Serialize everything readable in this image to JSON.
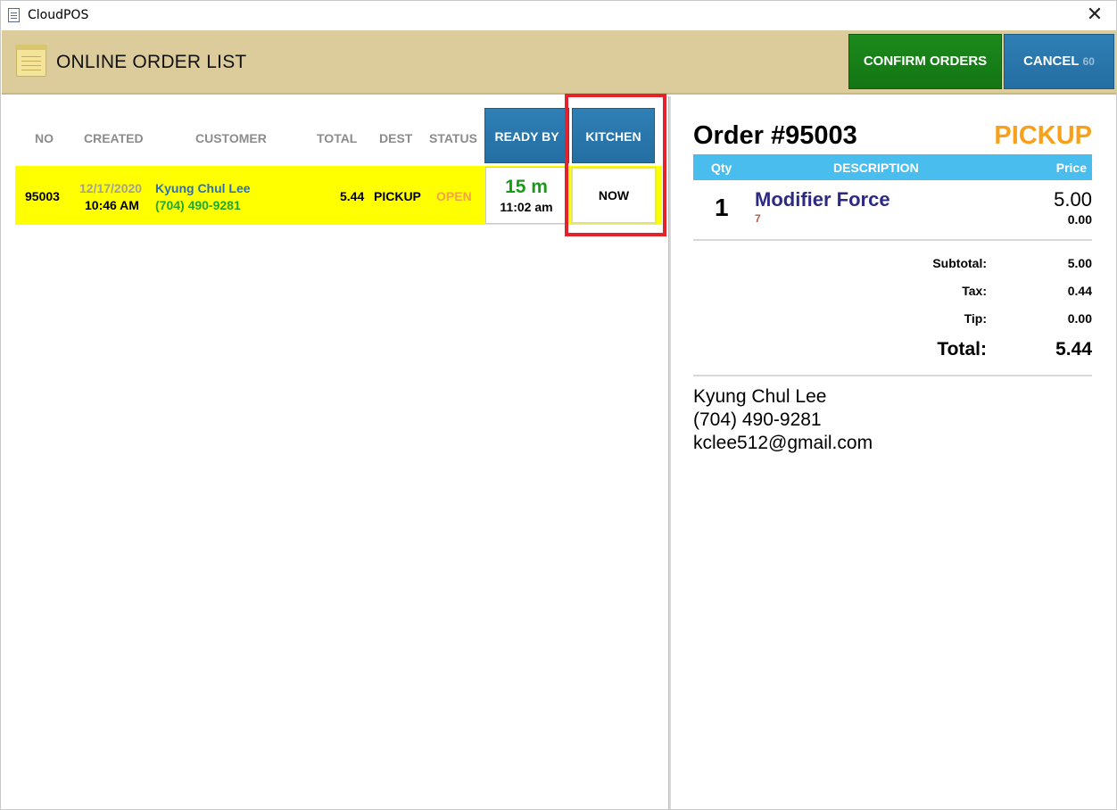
{
  "window": {
    "title": "CloudPOS",
    "close_glyph": "✕"
  },
  "header": {
    "title": "ONLINE ORDER LIST",
    "confirm_label": "CONFIRM ORDERS",
    "cancel_label": "CANCEL",
    "cancel_countdown": "60"
  },
  "order_list": {
    "columns": [
      "NO",
      "CREATED",
      "CUSTOMER",
      "TOTAL",
      "DEST",
      "STATUS"
    ],
    "ready_by_label": "READY BY",
    "kitchen_label": "KITCHEN",
    "rows": [
      {
        "no": "95003",
        "created_date": "12/17/2020",
        "created_time": "10:46 AM",
        "customer_name": "Kyung Chul Lee",
        "customer_phone": "(704) 490-9281",
        "total": "5.44",
        "dest": "PICKUP",
        "status": "OPEN",
        "ready_in": "15 m",
        "ready_at": "11:02 am",
        "kitchen": "NOW"
      }
    ]
  },
  "order_detail": {
    "title": "Order #95003",
    "type": "PICKUP",
    "headers": {
      "qty": "Qty",
      "description": "DESCRIPTION",
      "price": "Price"
    },
    "items": [
      {
        "qty": "1",
        "name": "Modifier Force",
        "modifier": "7",
        "price": "5.00",
        "modifier_price": "0.00"
      }
    ],
    "totals": {
      "subtotal_label": "Subtotal:",
      "subtotal": "5.00",
      "tax_label": "Tax:",
      "tax": "0.44",
      "tip_label": "Tip:",
      "tip": "0.00",
      "total_label": "Total:",
      "total": "5.44"
    },
    "customer": {
      "name": "Kyung Chul Lee",
      "phone": "(704) 490-9281",
      "email": "kclee512@gmail.com"
    }
  },
  "colors": {
    "header_bg": "#dccb9b",
    "confirm_green": "#1c8a1c",
    "button_blue": "#2f7fb5",
    "row_highlight": "#ffff00",
    "pickup_orange": "#f7a01c",
    "items_header_blue": "#4abdef",
    "annotation_red": "#e3222c"
  },
  "icons": [
    "document-icon",
    "notepad-icon",
    "close-icon"
  ]
}
